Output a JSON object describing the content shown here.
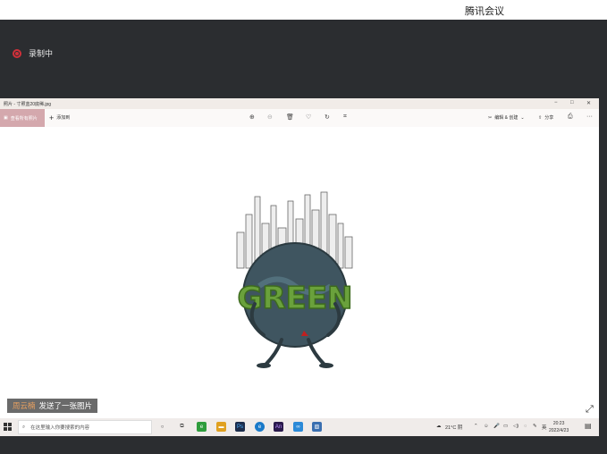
{
  "app": {
    "title": "腾讯会议"
  },
  "recording": {
    "label": "录制中"
  },
  "photos_window": {
    "title": "照片 - 寸照蓝20底稀.jpg",
    "controls": [
      "−",
      "□",
      "✕"
    ],
    "toolbar": {
      "save_label": "查看所有照片",
      "add_label": "添加到",
      "edit_label": "编辑 & 创建",
      "share_label": "分享"
    }
  },
  "chat": {
    "sender": "周云楠",
    "message": "发送了一张图片"
  },
  "taskbar": {
    "search_placeholder": "在这里输入你要搜索的内容",
    "weather": "21°C 阴",
    "input_method": "英",
    "time": "20:23",
    "date": "2022/4/23"
  },
  "artwork": {
    "text": "GREEN"
  },
  "colors": {
    "recording": "#d0303a",
    "save_button": "#d4a8ad",
    "sender": "#e8a060"
  }
}
